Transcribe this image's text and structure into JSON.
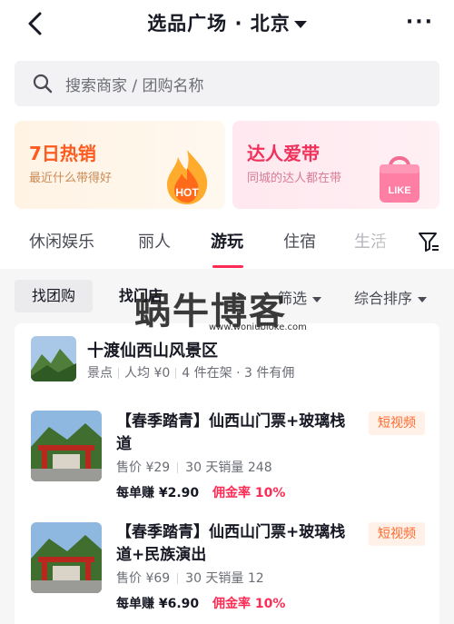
{
  "header": {
    "title": "选品广场 · 北京",
    "more": "···"
  },
  "search": {
    "placeholder": "搜索商家 / 团购名称"
  },
  "banners": [
    {
      "title": "7日热销",
      "subtitle": "最近什么带得好",
      "badge": "HOT",
      "color": "#ff5a1f"
    },
    {
      "title": "达人爱带",
      "subtitle": "同城的达人都在带",
      "badge": "LIKE",
      "color": "#f0315c"
    }
  ],
  "tabs": [
    {
      "label": "休闲娱乐",
      "active": false
    },
    {
      "label": "丽人",
      "active": false
    },
    {
      "label": "游玩",
      "active": true
    },
    {
      "label": "住宿",
      "active": false
    },
    {
      "label": "生活",
      "active": false
    }
  ],
  "filters": {
    "chips": [
      "找团购",
      "找门店"
    ],
    "sorts": [
      "筛选",
      "综合排序"
    ]
  },
  "watermark": {
    "text": "蜗牛博客",
    "url": "www.woniubloke.com"
  },
  "shop": {
    "name": "十渡仙西山风景区",
    "meta": [
      "景点",
      "人均 ¥0",
      "4 件在架 · 3 件有佣"
    ]
  },
  "products": [
    {
      "title": "【春季踏青】仙西山门票+玻璃栈道",
      "tag": "短视频",
      "price": "售价 ¥29",
      "sales": "30 天销量 248",
      "earn": "每单赚 ¥2.90",
      "commission": "佣金率 10%"
    },
    {
      "title": "【春季踏青】仙西山门票+玻璃栈道+民族演出",
      "tag": "短视频",
      "price": "售价 ¥69",
      "sales": "30 天销量 12",
      "earn": "每单赚 ¥6.90",
      "commission": "佣金率 10%"
    }
  ],
  "colors": {
    "accent": "#fe2c55",
    "tag_bg": "#fff0e8",
    "tag_text": "#ff6a2c"
  }
}
